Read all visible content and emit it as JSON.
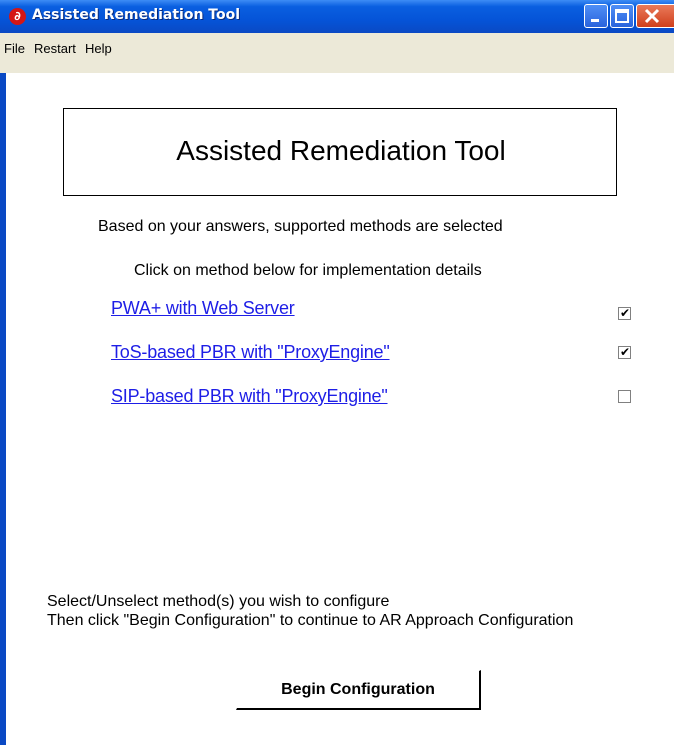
{
  "window": {
    "title": "Assisted Remediation Tool",
    "icon": "app-logo-icon"
  },
  "menu": [
    "File",
    "Restart",
    "Help"
  ],
  "heading": "Assisted Remediation Tool",
  "info": {
    "line1": "Based on your answers, supported methods are selected",
    "line2": "Click on method below for implementation details"
  },
  "methods": [
    {
      "label": "PWA+ with Web Server",
      "checked": true
    },
    {
      "label": "ToS-based PBR with \"ProxyEngine\"",
      "checked": true
    },
    {
      "label": "SIP-based PBR with \"ProxyEngine\"",
      "checked": false
    }
  ],
  "instructions": {
    "line1": "Select/Unselect method(s) you wish to configure",
    "line2": "Then click \"Begin Configuration\" to continue to AR Approach Configuration"
  },
  "begin_button": "Begin Configuration",
  "colors": {
    "titlebar": "#0554d8",
    "link": "#1e1ee6",
    "close": "#cf3f1c"
  }
}
